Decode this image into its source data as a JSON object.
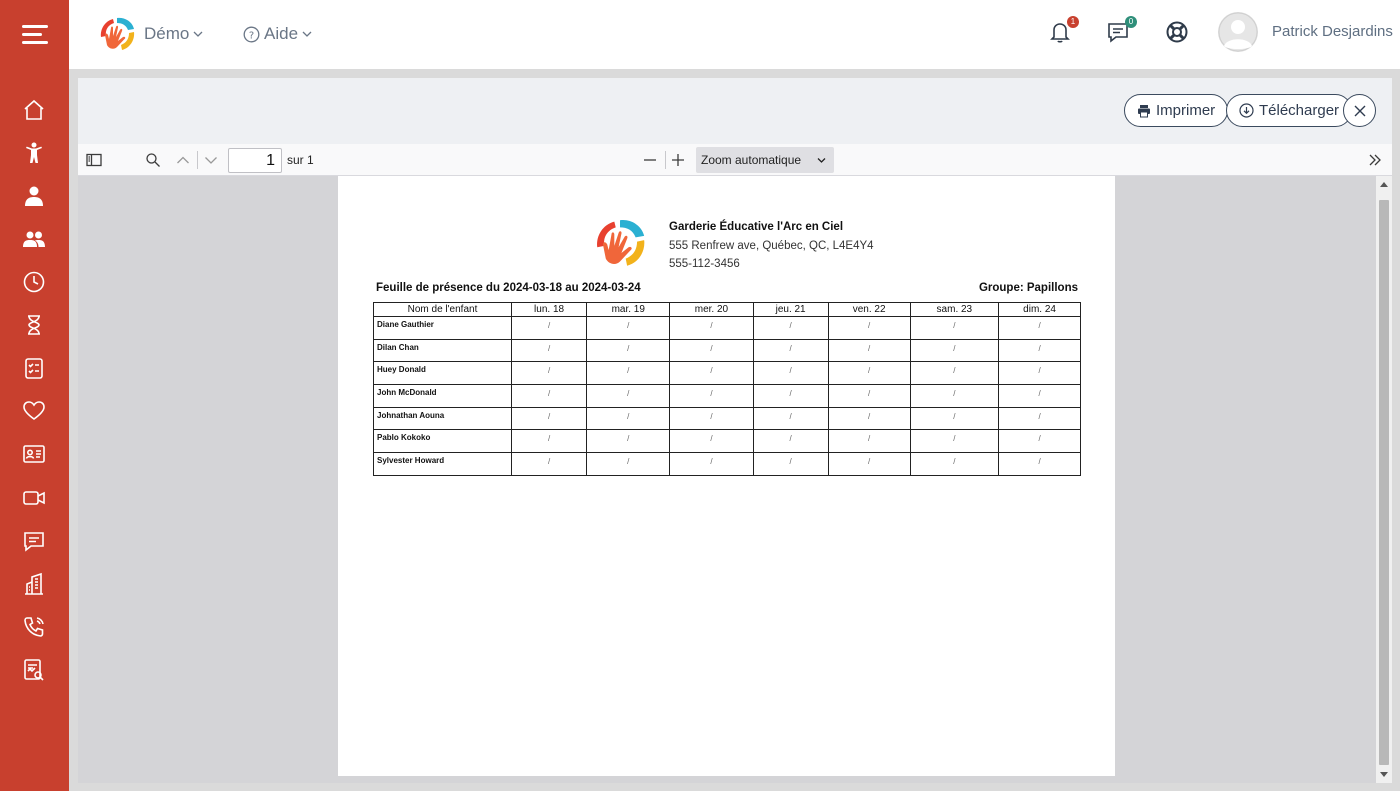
{
  "topbar": {
    "org_menu": "Démo",
    "help_menu": "Aide",
    "notifications_count": "1",
    "messages_count": "0",
    "user_name": "Patrick Desjardins"
  },
  "sidebar": {
    "icons": [
      "home-icon",
      "child-icon",
      "staff-icon",
      "group-icon",
      "clock-icon",
      "hourglass-icon",
      "checklist-icon",
      "heart-icon",
      "id-card-icon",
      "video-icon",
      "chat-icon",
      "building-icon",
      "phone-icon",
      "report-icon"
    ]
  },
  "viewer": {
    "print_label": "Imprimer",
    "download_label": "Télécharger",
    "page_number": "1",
    "page_of": "sur 1",
    "zoom": "Zoom automatique"
  },
  "document": {
    "org_name": "Garderie Éducative l'Arc en Ciel",
    "org_address": "555 Renfrew ave, Québec, QC, L4E4Y4",
    "org_phone": "555-112-3456",
    "sheet_title": "Feuille de présence du 2024-03-18 au 2024-03-24",
    "group_title": "Groupe: Papillons",
    "columns": [
      "Nom de l'enfant",
      "lun. 18",
      "mar. 19",
      "mer. 20",
      "jeu. 21",
      "ven. 22",
      "sam. 23",
      "dim. 24"
    ],
    "slot_placeholder": "/",
    "children": [
      "Diane Gauthier",
      "Dilan Chan",
      "Huey Donald",
      "John McDonald",
      "Johnathan Aouna",
      "Pablo Kokoko",
      "Sylvester Howard"
    ]
  },
  "colors": {
    "sidebar": "#c8402e",
    "notification_badge": "#c8402e",
    "message_badge": "#2f8f7a"
  }
}
